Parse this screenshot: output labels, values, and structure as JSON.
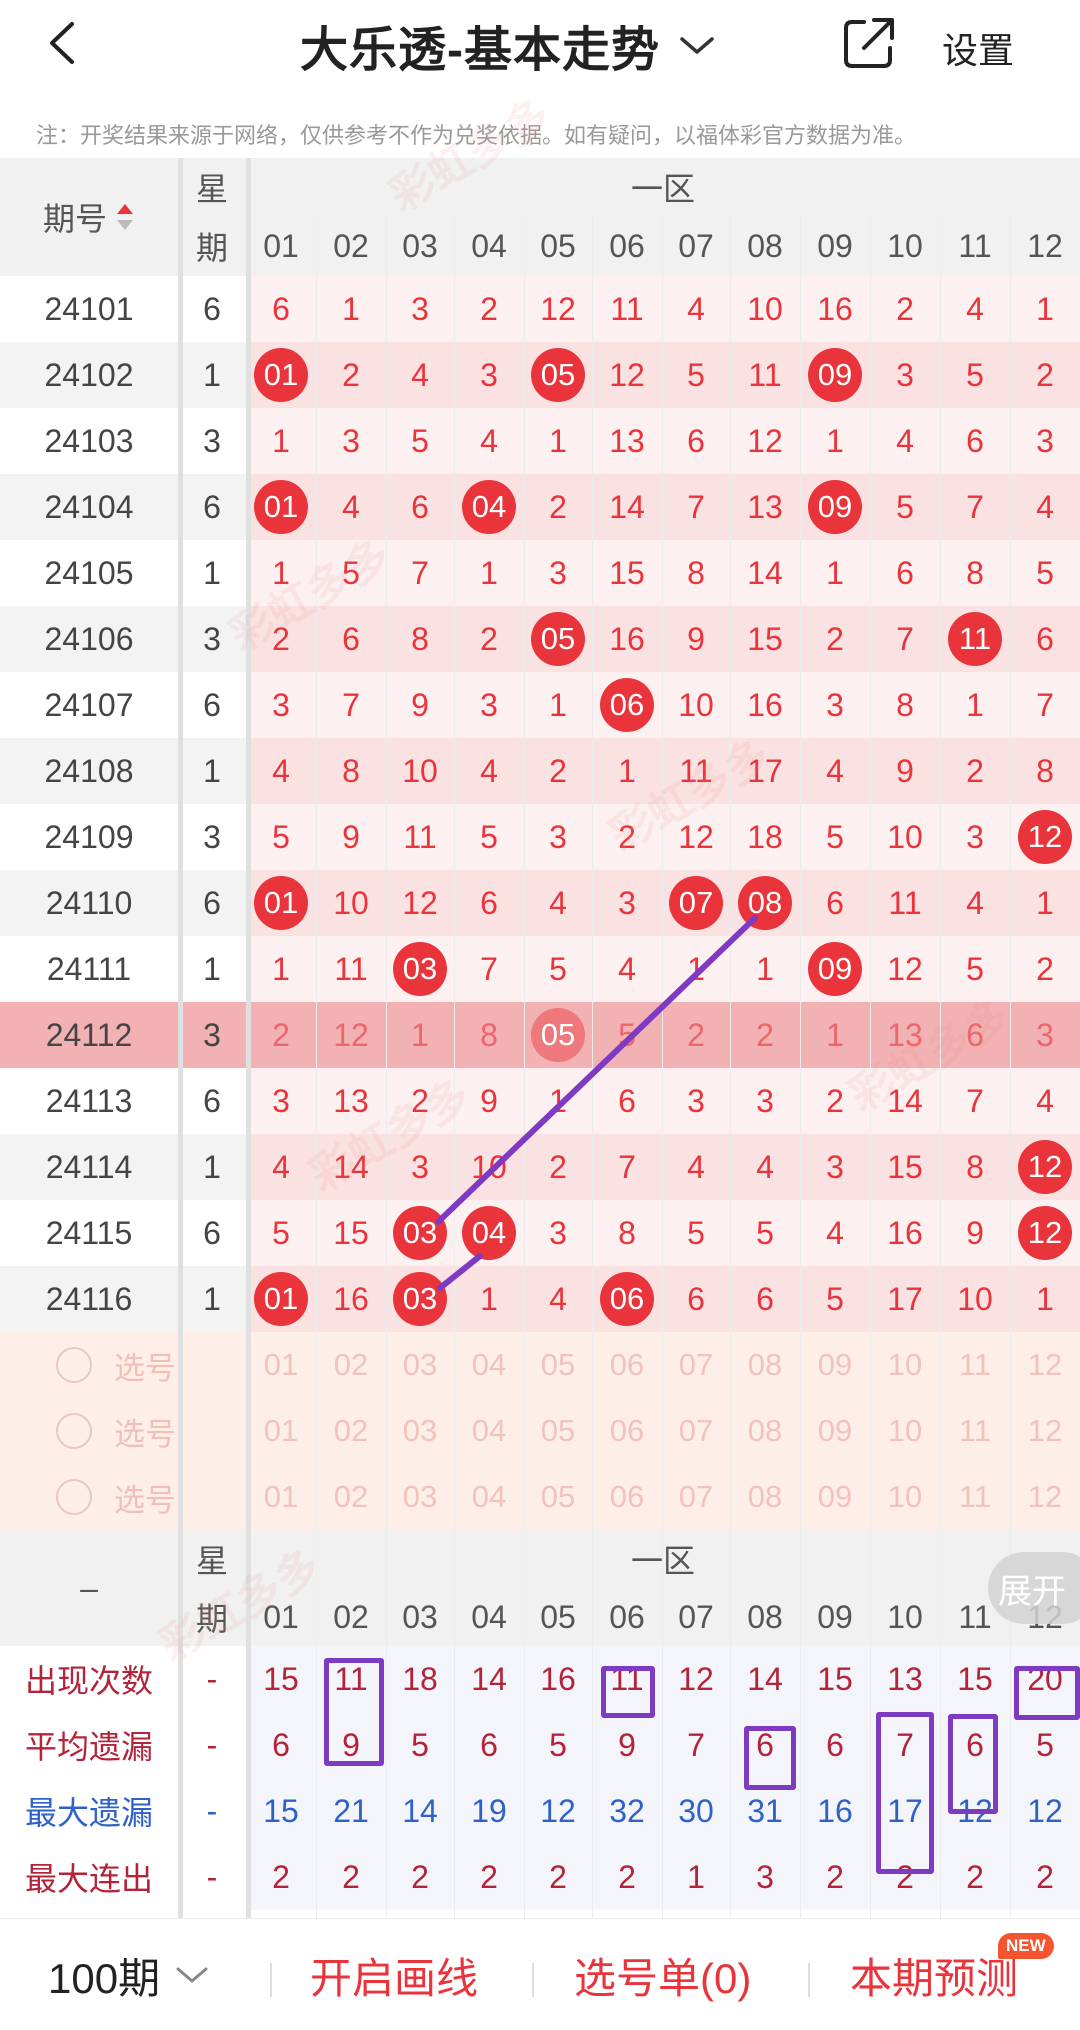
{
  "header": {
    "title": "大乐透-基本走势",
    "settings_label": "设置"
  },
  "notice": "注：开奖结果来源于网络，仅供参考不作为兑奖依据。如有疑问，以福体彩官方数据为准。",
  "table": {
    "period_label": "期号",
    "week_label_top": "星",
    "week_label_bottom": "期",
    "zone_label": "一区",
    "columns": [
      "01",
      "02",
      "03",
      "04",
      "05",
      "06",
      "07",
      "08",
      "09",
      "10",
      "11",
      "12"
    ],
    "rows": [
      {
        "period": "24101",
        "week": "6",
        "values": [
          "6",
          "1",
          "3",
          "2",
          "12",
          "11",
          "4",
          "10",
          "16",
          "2",
          "4",
          "1"
        ],
        "hits": []
      },
      {
        "period": "24102",
        "week": "1",
        "values": [
          "01",
          "2",
          "4",
          "3",
          "05",
          "12",
          "5",
          "11",
          "09",
          "3",
          "5",
          "2"
        ],
        "hits": [
          0,
          4,
          8
        ]
      },
      {
        "period": "24103",
        "week": "3",
        "values": [
          "1",
          "3",
          "5",
          "4",
          "1",
          "13",
          "6",
          "12",
          "1",
          "4",
          "6",
          "3"
        ],
        "hits": []
      },
      {
        "period": "24104",
        "week": "6",
        "values": [
          "01",
          "4",
          "6",
          "04",
          "2",
          "14",
          "7",
          "13",
          "09",
          "5",
          "7",
          "4"
        ],
        "hits": [
          0,
          3,
          8
        ]
      },
      {
        "period": "24105",
        "week": "1",
        "values": [
          "1",
          "5",
          "7",
          "1",
          "3",
          "15",
          "8",
          "14",
          "1",
          "6",
          "8",
          "5"
        ],
        "hits": []
      },
      {
        "period": "24106",
        "week": "3",
        "values": [
          "2",
          "6",
          "8",
          "2",
          "05",
          "16",
          "9",
          "15",
          "2",
          "7",
          "11",
          "6"
        ],
        "hits": [
          4,
          10
        ]
      },
      {
        "period": "24107",
        "week": "6",
        "values": [
          "3",
          "7",
          "9",
          "3",
          "1",
          "06",
          "10",
          "16",
          "3",
          "8",
          "1",
          "7"
        ],
        "hits": [
          5
        ]
      },
      {
        "period": "24108",
        "week": "1",
        "values": [
          "4",
          "8",
          "10",
          "4",
          "2",
          "1",
          "11",
          "17",
          "4",
          "9",
          "2",
          "8"
        ],
        "hits": []
      },
      {
        "period": "24109",
        "week": "3",
        "values": [
          "5",
          "9",
          "11",
          "5",
          "3",
          "2",
          "12",
          "18",
          "5",
          "10",
          "3",
          "12"
        ],
        "hits": [
          11
        ]
      },
      {
        "period": "24110",
        "week": "6",
        "values": [
          "01",
          "10",
          "12",
          "6",
          "4",
          "3",
          "07",
          "08",
          "6",
          "11",
          "4",
          "1"
        ],
        "hits": [
          0,
          6,
          7
        ]
      },
      {
        "period": "24111",
        "week": "1",
        "values": [
          "1",
          "11",
          "03",
          "7",
          "5",
          "4",
          "1",
          "1",
          "09",
          "12",
          "5",
          "2"
        ],
        "hits": [
          2,
          8
        ]
      },
      {
        "period": "24112",
        "week": "3",
        "values": [
          "2",
          "12",
          "1",
          "8",
          "05",
          "5",
          "2",
          "2",
          "1",
          "13",
          "6",
          "3"
        ],
        "hits": [
          4
        ],
        "highlight": true
      },
      {
        "period": "24113",
        "week": "6",
        "values": [
          "3",
          "13",
          "2",
          "9",
          "1",
          "6",
          "3",
          "3",
          "2",
          "14",
          "7",
          "4"
        ],
        "hits": []
      },
      {
        "period": "24114",
        "week": "1",
        "values": [
          "4",
          "14",
          "3",
          "10",
          "2",
          "7",
          "4",
          "4",
          "3",
          "15",
          "8",
          "12"
        ],
        "hits": [
          11
        ]
      },
      {
        "period": "24115",
        "week": "6",
        "values": [
          "5",
          "15",
          "03",
          "04",
          "3",
          "8",
          "5",
          "5",
          "4",
          "16",
          "9",
          "12"
        ],
        "hits": [
          2,
          3,
          11
        ]
      },
      {
        "period": "24116",
        "week": "1",
        "values": [
          "01",
          "16",
          "03",
          "1",
          "4",
          "06",
          "6",
          "6",
          "5",
          "17",
          "10",
          "1"
        ],
        "hits": [
          0,
          2,
          5
        ]
      }
    ],
    "pick_label": "选号",
    "pick_rows": 3
  },
  "stats": {
    "dash": "–",
    "week_top": "星",
    "week_bottom": "期",
    "zone_label": "一区",
    "expand_label": "展开",
    "rows": [
      {
        "label": "出现次数",
        "color": "#b3243a",
        "week": "-",
        "values": [
          "15",
          "11",
          "18",
          "14",
          "16",
          "11",
          "12",
          "14",
          "15",
          "13",
          "15",
          "20"
        ]
      },
      {
        "label": "平均遗漏",
        "color": "#b3243a",
        "week": "-",
        "values": [
          "6",
          "9",
          "5",
          "6",
          "5",
          "9",
          "7",
          "6",
          "6",
          "7",
          "6",
          "5"
        ]
      },
      {
        "label": "最大遗漏",
        "color": "#2f62c8",
        "week": "-",
        "values": [
          "15",
          "21",
          "14",
          "19",
          "12",
          "32",
          "30",
          "31",
          "16",
          "17",
          "12",
          "12"
        ]
      },
      {
        "label": "最大连出",
        "color": "#b3243a",
        "week": "-",
        "values": [
          "2",
          "2",
          "2",
          "2",
          "2",
          "2",
          "1",
          "3",
          "2",
          "2",
          "2",
          "2"
        ]
      }
    ]
  },
  "bottom_bar": {
    "periods": "100期",
    "draw_line": "开启画线",
    "pick_list": "选号单(0)",
    "forecast": "本期预测",
    "new_badge": "NEW"
  },
  "colors": {
    "red": "#e8343a",
    "purple": "#7f3ac2",
    "pink_band": "#fdecec",
    "highlight_band": "#f2b1b3"
  }
}
